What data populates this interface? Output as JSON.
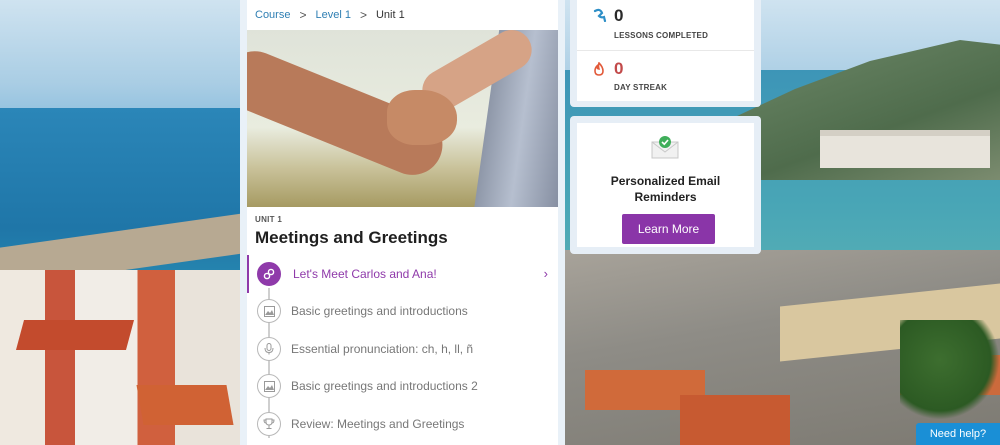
{
  "breadcrumb": {
    "items": [
      "Course",
      "Level 1",
      "Unit 1"
    ],
    "separator": ">"
  },
  "unit": {
    "label": "UNIT 1",
    "title": "Meetings and Greetings"
  },
  "lessons": [
    {
      "title": "Let's Meet Carlos and Ana!",
      "icon": "link-icon",
      "active": true
    },
    {
      "title": "Basic greetings and introductions",
      "icon": "image-icon",
      "active": false
    },
    {
      "title": "Essential pronunciation: ch, h, ll, ñ",
      "icon": "microphone-icon",
      "active": false
    },
    {
      "title": "Basic greetings and introductions 2",
      "icon": "image-icon",
      "active": false
    },
    {
      "title": "Review: Meetings and Greetings",
      "icon": "trophy-icon",
      "active": false
    }
  ],
  "stats": {
    "lessons_completed": {
      "value": "0",
      "label": "LESSONS COMPLETED",
      "icon": "lesson-icon"
    },
    "day_streak": {
      "value": "0",
      "label": "DAY STREAK",
      "icon": "flame-icon"
    }
  },
  "email_reminders": {
    "title_line1": "Personalized Email",
    "title_line2": "Reminders",
    "button": "Learn More"
  },
  "help": {
    "label": "Need help?"
  },
  "colors": {
    "accent": "#8a35a8",
    "link": "#2f7fb3",
    "help": "#1a8fd6"
  }
}
